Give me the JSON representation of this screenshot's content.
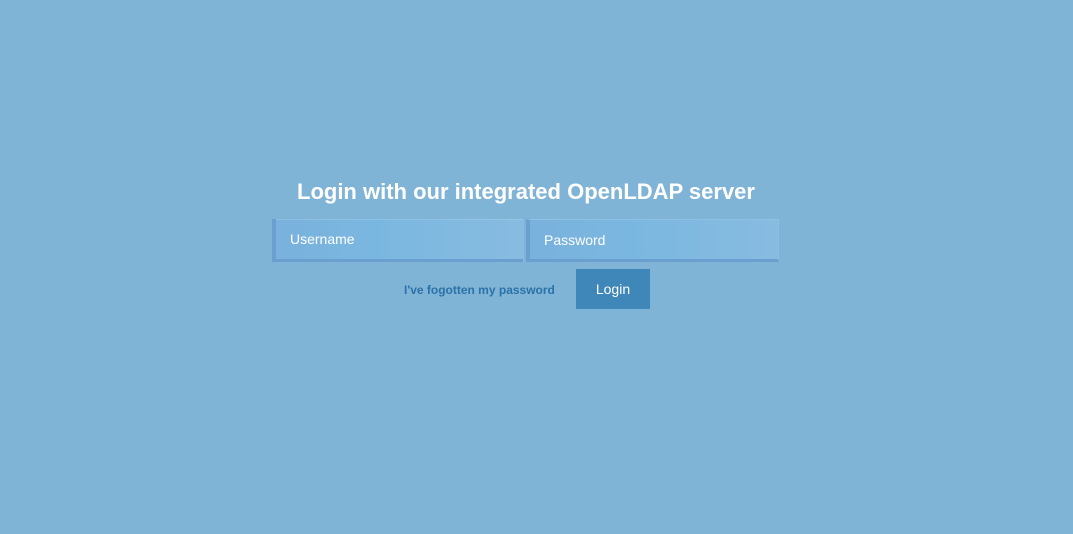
{
  "colors": {
    "background": "#80b4d6",
    "button": "#3f87b9",
    "link": "#2a72a8",
    "field_border": "#6a9fd0"
  },
  "login": {
    "title": "Login with our integrated OpenLDAP server",
    "username_placeholder": "Username",
    "password_placeholder": "Password",
    "forgot_link": "I've fogotten my password",
    "submit_label": "Login"
  }
}
